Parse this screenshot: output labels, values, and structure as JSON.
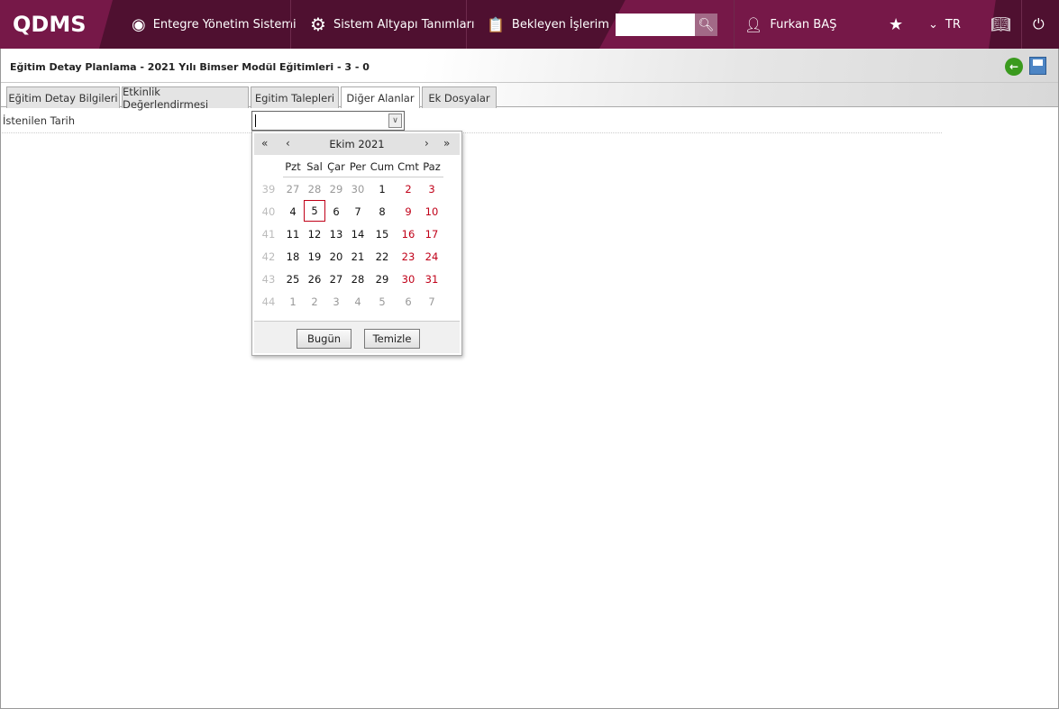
{
  "header": {
    "logo": "QDMS",
    "nav": [
      {
        "label": "Entegre Yönetim Sistemi",
        "icon": "q-logo-icon"
      },
      {
        "label": "Sistem Altyapı Tanımları",
        "icon": "gear-icon"
      },
      {
        "label": "Bekleyen İşlerim",
        "icon": "clipboard-icon"
      }
    ],
    "search_value": "",
    "user": "Furkan BAŞ",
    "language": "TR",
    "colors": {
      "dark": "#4f1030",
      "light": "#761848"
    }
  },
  "page": {
    "title": "Eğitim Detay Planlama - 2021 Yılı Bimser Modül Eğitimleri - 3 - 0"
  },
  "tabs": [
    "Eğitim Detay Bilgileri",
    "Etkinlik Değerlendirmesi",
    "Egitim Talepleri",
    "Diğer Alanlar",
    "Ek Dosyalar"
  ],
  "active_tab": "Diğer Alanlar",
  "form": {
    "label": "İstenilen Tarih",
    "value": ""
  },
  "calendar": {
    "month": "Ekim 2021",
    "weekdays": [
      "Pzt",
      "Sal",
      "Çar",
      "Per",
      "Cum",
      "Cmt",
      "Paz"
    ],
    "weeks": [
      {
        "n": "39",
        "days": [
          "27",
          "28",
          "29",
          "30",
          "1",
          "2",
          "3"
        ]
      },
      {
        "n": "40",
        "days": [
          "4",
          "5",
          "6",
          "7",
          "8",
          "9",
          "10"
        ]
      },
      {
        "n": "41",
        "days": [
          "11",
          "12",
          "13",
          "14",
          "15",
          "16",
          "17"
        ]
      },
      {
        "n": "42",
        "days": [
          "18",
          "19",
          "20",
          "21",
          "22",
          "23",
          "24"
        ]
      },
      {
        "n": "43",
        "days": [
          "25",
          "26",
          "27",
          "28",
          "29",
          "30",
          "31"
        ]
      },
      {
        "n": "44",
        "days": [
          "1",
          "2",
          "3",
          "4",
          "5",
          "6",
          "7"
        ]
      }
    ],
    "selected": "5",
    "today_label": "Bugün",
    "clear_label": "Temizle"
  }
}
